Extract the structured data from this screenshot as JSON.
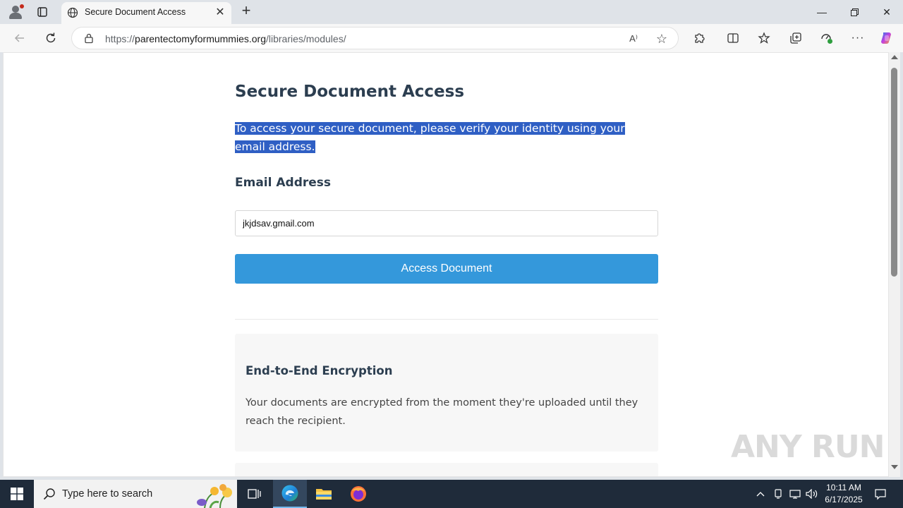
{
  "browser": {
    "tab_title": "Secure Document Access",
    "url_prefix": "https://",
    "url_host": "parentectomyformummies.org",
    "url_path": "/libraries/modules/",
    "readaloud_glyph": "A⁾"
  },
  "page": {
    "title": "Secure Document Access",
    "intro": "To access your secure document, please verify your identity using your email address.",
    "email_label": "Email Address",
    "email_value": "jkjdsav.gmail.com",
    "access_button": "Access Document",
    "feature": {
      "title": "End-to-End Encryption",
      "text": "Your documents are encrypted from the moment they're uploaded until they reach the recipient."
    }
  },
  "watermark": "ANY RUN",
  "taskbar": {
    "search_placeholder": "Type here to search",
    "time": "10:11 AM",
    "date": "6/17/2025"
  },
  "colors": {
    "accent_button": "#3498db",
    "heading": "#2c3e50",
    "selection": "#2f5fc4"
  },
  "icons": [
    "profile-icon",
    "tab-actions-icon",
    "globe-icon",
    "close-icon",
    "new-tab-icon",
    "minimize-icon",
    "maximize-icon",
    "back-icon",
    "reload-icon",
    "lock-icon",
    "read-aloud-icon",
    "favorite-star-icon",
    "extensions-icon",
    "split-screen-icon",
    "favorites-icon",
    "collections-icon",
    "performance-icon",
    "more-icon",
    "copilot-icon",
    "windows-start-icon",
    "search-icon",
    "task-view-icon",
    "edge-icon",
    "file-explorer-icon",
    "firefox-icon",
    "chevron-up-icon",
    "wifi-icon",
    "network-icon",
    "volume-icon",
    "notification-icon"
  ]
}
